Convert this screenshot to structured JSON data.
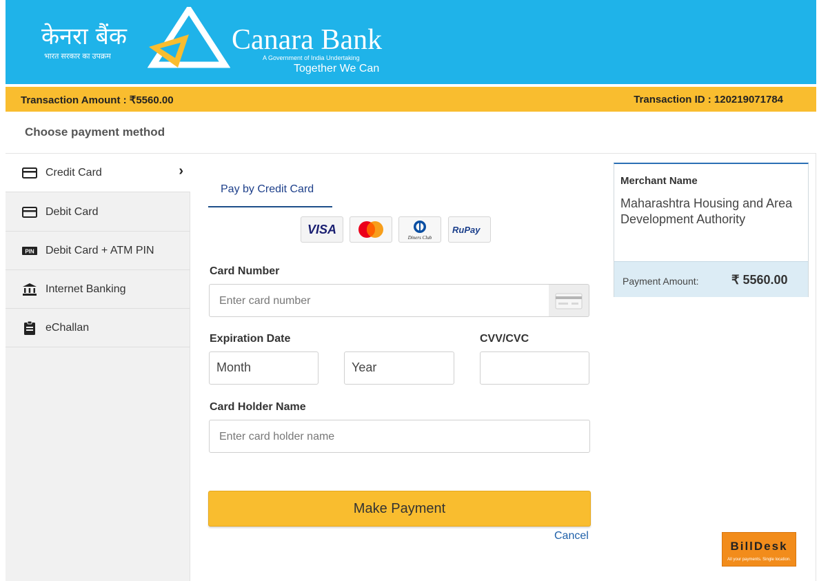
{
  "header": {
    "hindi_name": "केनरा बैंक",
    "hindi_sub": "भारत सरकार का उपक्रम",
    "bank_name": "Canara Bank",
    "bank_sub": "A Government of India Undertaking",
    "tagline": "Together We Can"
  },
  "transaction": {
    "amount": "Transaction Amount : ₹5560.00",
    "id": "Transaction ID : 120219071784"
  },
  "choose_label": "Choose payment method",
  "sidebar": {
    "items": [
      {
        "label": "Credit Card",
        "icon": "credit-card-icon",
        "active": true
      },
      {
        "label": "Debit Card",
        "icon": "debit-card-icon",
        "active": false
      },
      {
        "label": "Debit Card + ATM PIN",
        "icon": "pin-icon",
        "active": false
      },
      {
        "label": "Internet Banking",
        "icon": "bank-icon",
        "active": false
      },
      {
        "label": "eChallan",
        "icon": "clipboard-icon",
        "active": false
      }
    ]
  },
  "form": {
    "tab_label": "Pay by Credit Card",
    "card_logos": [
      "VISA",
      "Mastercard",
      "Diners Club",
      "RuPay"
    ],
    "card_number_label": "Card Number",
    "card_number_placeholder": "Enter card number",
    "expiration_label": "Expiration Date",
    "month_value": "Month",
    "year_value": "Year",
    "cvv_label": "CVV/CVC",
    "holder_label": "Card Holder Name",
    "holder_placeholder": "Enter card holder name",
    "pay_button": "Make Payment",
    "cancel": "Cancel"
  },
  "merchant": {
    "title": "Merchant Name",
    "name": "Maharashtra Housing and Area Development Authority",
    "payment_label": "Payment Amount:",
    "payment_value": "₹ 5560.00"
  },
  "billdesk": {
    "name": "BillDesk",
    "slogan": "All your payments. Single location."
  },
  "colors": {
    "header": "#1fb3e9",
    "accent": "#f9bd2f",
    "tab": "#1d3f8a"
  }
}
